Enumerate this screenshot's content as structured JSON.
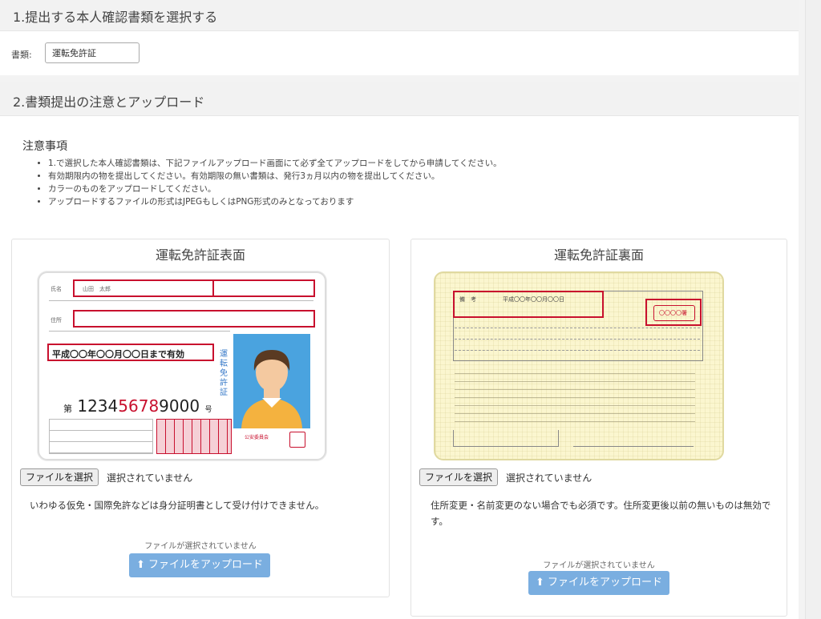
{
  "section1": {
    "title": "1.提出する本人確認書類を選択する",
    "doc_label": "書類:",
    "doc_value": "運転免許証"
  },
  "section2": {
    "title": "2.書類提出の注意とアップロード",
    "notes_title": "注意事項",
    "notes": [
      "1.で選択した本人確認書類は、下記ファイルアップロード画面にて必ず全てアップロードをしてから申請してください。",
      "有効期限内の物を提出してください。有効期限の無い書類は、発行3ヵ月以内の物を提出してください。",
      "カラーのものをアップロードしてください。",
      "アップロードするファイルの形式はJPEGもしくはPNG形式のみとなっております"
    ]
  },
  "front": {
    "title": "運転免許証表面",
    "card": {
      "name_label": "氏名",
      "name_value": "山田　太郎",
      "addr_label": "住所",
      "expiry": "平成〇〇年〇〇月〇〇日まで有効",
      "number_prefix": "第",
      "number_a": "1234",
      "number_b": "5678",
      "number_c": "9000",
      "number_suffix": "号",
      "vertical": "運転免許証",
      "authority": "公安委員会"
    },
    "file_button": "ファイルを選択",
    "file_status": "選択されていません",
    "hint": "いわゆる仮免・国際免許などは身分証明書として受け付けできません。",
    "no_file": "ファイルが選択されていません",
    "upload": "ファイルをアップロード"
  },
  "back": {
    "title": "運転免許証裏面",
    "card": {
      "row_label": "備　考",
      "date": "平成〇〇年〇〇月〇〇日",
      "stamp": "〇〇〇〇署"
    },
    "file_button": "ファイルを選択",
    "file_status": "選択されていません",
    "hint": "住所変更・名前変更のない場合でも必須です。住所変更後以前の無いものは無効です。",
    "no_file": "ファイルが選択されていません",
    "upload": "ファイルをアップロード"
  },
  "icons": {
    "upload": "upload-icon"
  }
}
